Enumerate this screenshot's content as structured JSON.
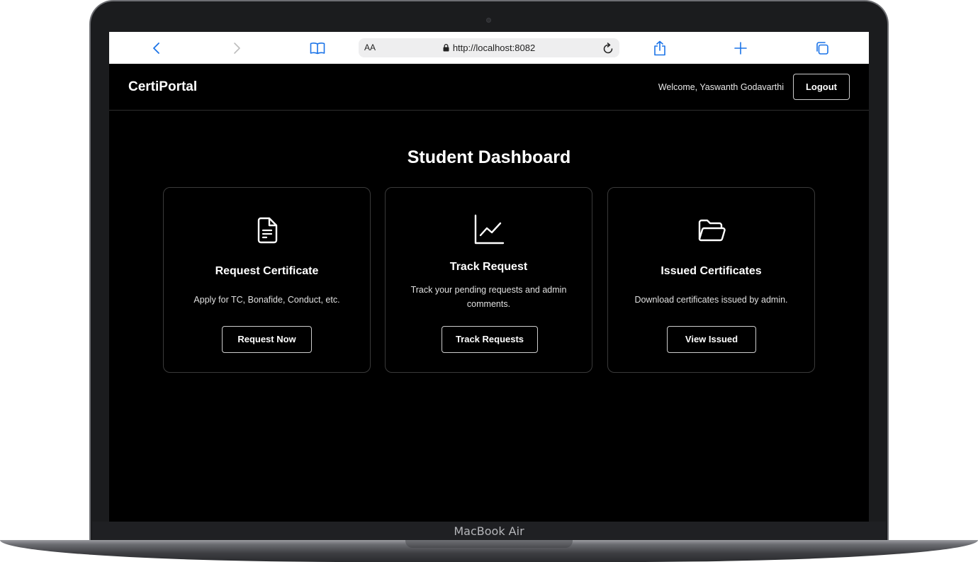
{
  "device": {
    "model_label": "MacBook Air"
  },
  "browser": {
    "aa_label": "AA",
    "url": "http://localhost:8082",
    "icons": [
      "back-icon",
      "forward-icon",
      "bookmarks-icon",
      "lock-icon",
      "reload-icon",
      "share-icon",
      "new-tab-icon",
      "tabs-icon"
    ],
    "accent_color": "#1a73e8"
  },
  "header": {
    "brand": "CertiPortal",
    "welcome": "Welcome, Yaswanth Godavarthi",
    "logout_label": "Logout"
  },
  "main": {
    "title": "Student Dashboard",
    "cards": [
      {
        "icon": "document-icon",
        "title": "Request Certificate",
        "description": "Apply for TC, Bonafide, Conduct, etc.",
        "button_label": "Request Now"
      },
      {
        "icon": "line-chart-icon",
        "title": "Track Request",
        "description": "Track your pending requests and admin comments.",
        "button_label": "Track Requests"
      },
      {
        "icon": "folder-icon",
        "title": "Issued Certificates",
        "description": "Download certificates issued by admin.",
        "button_label": "View Issued"
      }
    ]
  }
}
